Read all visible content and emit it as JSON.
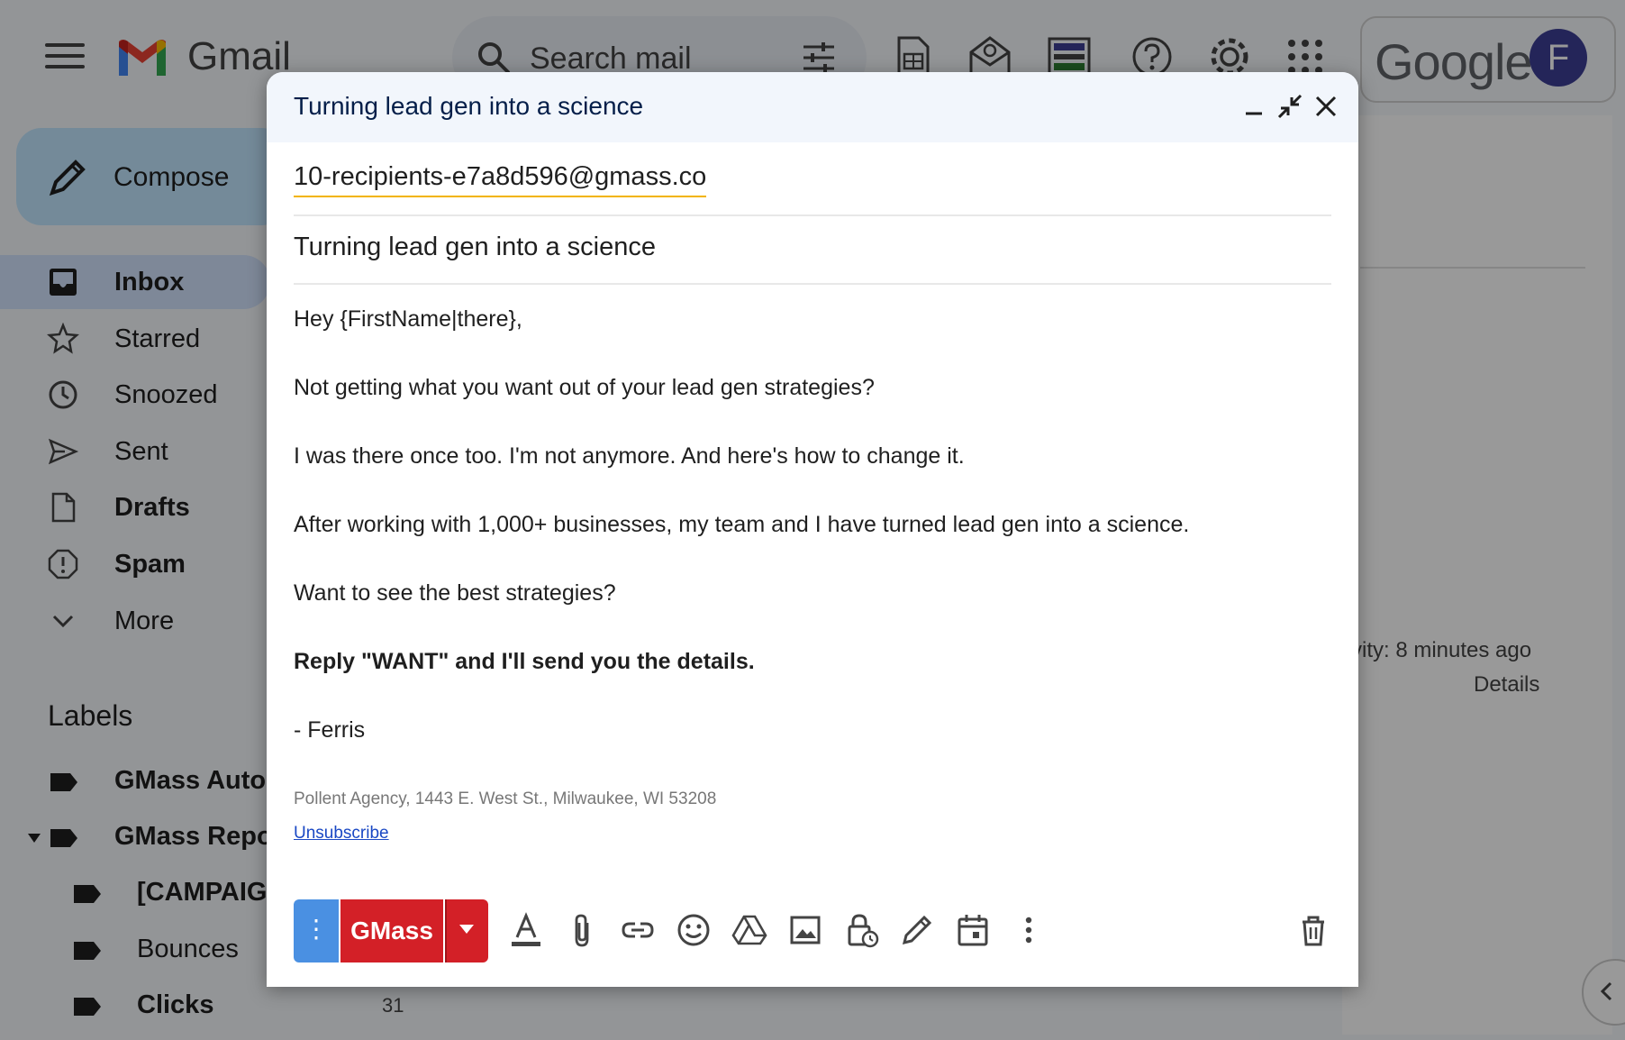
{
  "gmail": {
    "app_name": "Gmail",
    "search_placeholder": "Search mail",
    "google_word": "Google",
    "avatar_letter": "F",
    "compose_label": "Compose",
    "nav": [
      {
        "label": "Inbox",
        "icon": "inbox-icon"
      },
      {
        "label": "Starred",
        "icon": "star-icon"
      },
      {
        "label": "Snoozed",
        "icon": "clock-icon"
      },
      {
        "label": "Sent",
        "icon": "send-icon"
      },
      {
        "label": "Drafts",
        "icon": "file-icon"
      },
      {
        "label": "Spam",
        "icon": "alert-icon"
      },
      {
        "label": "More",
        "icon": "chevron-down-icon"
      }
    ],
    "labels_title": "Labels",
    "labels": [
      {
        "label": "GMass Auto"
      },
      {
        "label": "GMass Repor"
      },
      {
        "label": "[CAMPAIG"
      },
      {
        "label": "Bounces"
      },
      {
        "label": "Clicks",
        "count": "31"
      }
    ],
    "right_panel": {
      "activity": "vity: 8 minutes ago",
      "details": "Details"
    }
  },
  "compose": {
    "title": "Turning lead gen into a science",
    "to_recipient": "10-recipients-e7a8d596@gmass.co",
    "subject": "Turning lead gen into a science",
    "body": {
      "greeting": "Hey {FirstName|there},",
      "p1": "Not getting what you want out of your lead gen strategies?",
      "p2": "I was there once too. I'm not anymore. And here's how to change it.",
      "p3": "After working with 1,000+ businesses, my team and I have turned lead gen into a science.",
      "p4": "Want to see the best strategies?",
      "p5": "Reply \"WANT\" and I'll send you the details.",
      "signature": "- Ferris"
    },
    "footer_address": "Pollent Agency, 1443 E. West St., Milwaukee, WI 53208",
    "unsubscribe_label": "Unsubscribe",
    "toolbar": {
      "options_glyph": "⋮",
      "gmass_label": "GMass"
    }
  },
  "colors": {
    "gmass_red": "#d32027",
    "gmass_blue": "#4a90e2",
    "link_blue": "#1a48c4"
  }
}
